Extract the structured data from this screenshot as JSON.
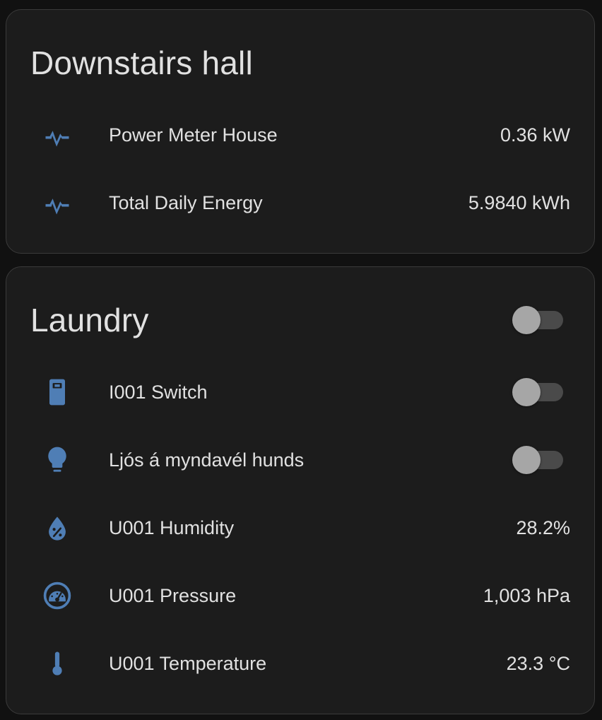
{
  "colors": {
    "icon": "#4f7eb5",
    "card_bg": "#1c1c1c",
    "page_bg": "#111111",
    "text": "#e1e1e1",
    "toggle_off_thumb": "#a6a6a6",
    "toggle_off_track": "#4a4a4a"
  },
  "downstairs": {
    "title": "Downstairs hall",
    "rows": [
      {
        "icon": "pulse-icon",
        "label": "Power Meter House",
        "value": "0.36 kW"
      },
      {
        "icon": "pulse-icon",
        "label": "Total Daily Energy",
        "value": "5.9840 kWh"
      }
    ]
  },
  "laundry": {
    "title": "Laundry",
    "header_toggle": "off",
    "rows": [
      {
        "icon": "switch-icon",
        "label": "I001 Switch",
        "state": "off"
      },
      {
        "icon": "lightbulb-icon",
        "label": "Ljós á myndavél hunds",
        "state": "off"
      },
      {
        "icon": "humidity-icon",
        "label": "U001 Humidity",
        "value": "28.2%"
      },
      {
        "icon": "gauge-icon",
        "label": "U001 Pressure",
        "value": "1,003 hPa"
      },
      {
        "icon": "thermometer-icon",
        "label": "U001 Temperature",
        "value": "23.3 °C"
      }
    ]
  }
}
